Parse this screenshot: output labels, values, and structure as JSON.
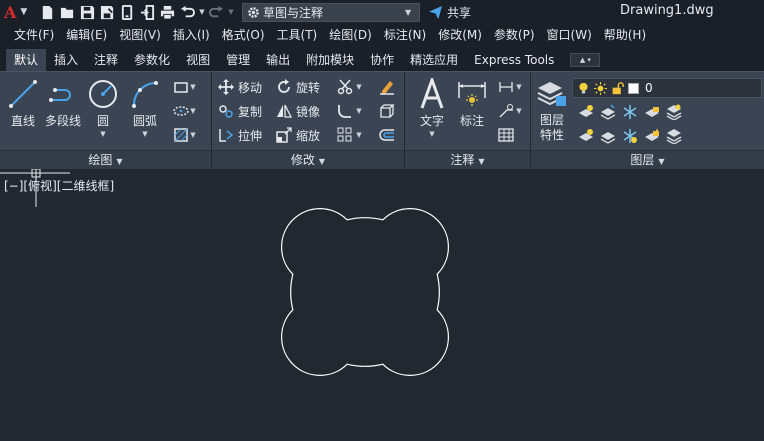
{
  "app": {
    "logo": "A",
    "document_title": "Drawing1.dwg"
  },
  "workspace": {
    "label": "草图与注释"
  },
  "share": {
    "label": "共享"
  },
  "menu": [
    "文件(F)",
    "编辑(E)",
    "视图(V)",
    "插入(I)",
    "格式(O)",
    "工具(T)",
    "绘图(D)",
    "标注(N)",
    "修改(M)",
    "参数(P)",
    "窗口(W)",
    "帮助(H)"
  ],
  "tabs": [
    "默认",
    "插入",
    "注释",
    "参数化",
    "视图",
    "管理",
    "输出",
    "附加模块",
    "协作",
    "精选应用",
    "Express Tools"
  ],
  "active_tab": "默认",
  "panels": {
    "draw": {
      "title": "绘图",
      "tools": {
        "line": "直线",
        "polyline": "多段线",
        "circle": "圆",
        "arc": "圆弧"
      }
    },
    "modify": {
      "title": "修改",
      "tools": {
        "move": "移动",
        "rotate": "旋转",
        "copy": "复制",
        "mirror": "镜像",
        "stretch": "拉伸",
        "scale": "缩放"
      }
    },
    "annotate": {
      "title": "注释",
      "tools": {
        "text": "文字",
        "dimension": "标注"
      }
    },
    "layers": {
      "title": "图层",
      "properties_line1": "图层",
      "properties_line2": "特性",
      "current_layer": "0"
    }
  },
  "viewport": {
    "label": "[−][俯视][二维线框]"
  },
  "colors": {
    "accent": "#4aa3e8",
    "logo": "#d62b2b",
    "background": "#212830",
    "ribbon": "#3a4452",
    "drawing_line": "#ffffff"
  }
}
